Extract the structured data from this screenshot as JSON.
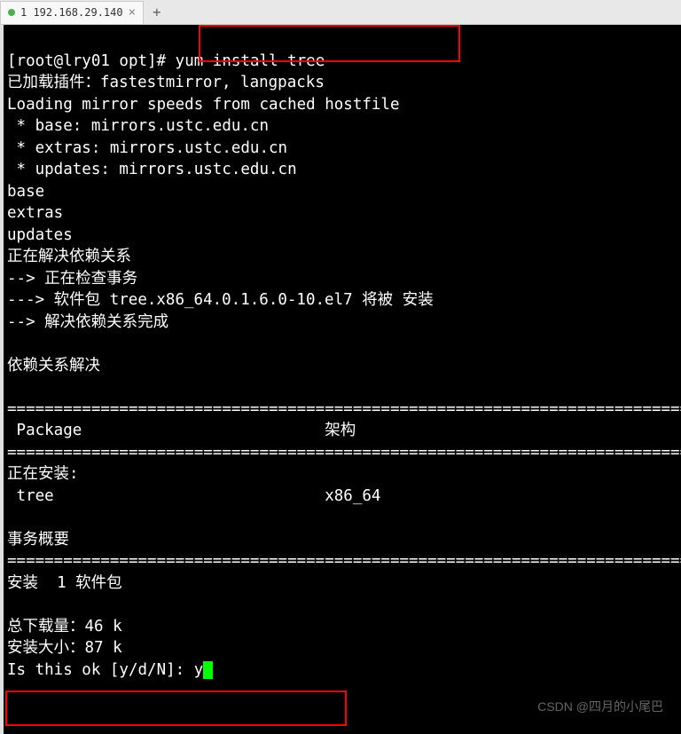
{
  "tab": {
    "title": "1 192.168.29.140",
    "underline_prefix": "1"
  },
  "term": {
    "prompt": "[root@lry01 opt]# ",
    "command": "yum install tree",
    "l2": "已加载插件：fastestmirror, langpacks",
    "l3": "Loading mirror speeds from cached hostfile",
    "l4": " * base: mirrors.ustc.edu.cn",
    "l5": " * extras: mirrors.ustc.edu.cn",
    "l6": " * updates: mirrors.ustc.edu.cn",
    "l7": "base",
    "l8": "extras",
    "l9": "updates",
    "l10": "正在解决依赖关系",
    "l11": "--> 正在检查事务",
    "l12": "---> 软件包 tree.x86_64.0.1.6.0-10.el7 将被 安装",
    "l13": "--> 解决依赖关系完成",
    "l14": "",
    "l15": "依赖关系解决",
    "l16": "",
    "sep": "==========================================================================",
    "header_package": " Package",
    "header_arch": "架构",
    "l20": "正在安装:",
    "l21_name": " tree",
    "l21_arch": "x86_64",
    "l22": "",
    "l23": "事务概要",
    "l25": "安装  1 软件包",
    "l26": "",
    "l27": "总下载量：46 k",
    "l28": "安装大小：87 k",
    "l29_prompt": "Is this ok [y/d/N]: ",
    "l29_input": "y"
  },
  "watermark": "CSDN @四月的小尾巴"
}
